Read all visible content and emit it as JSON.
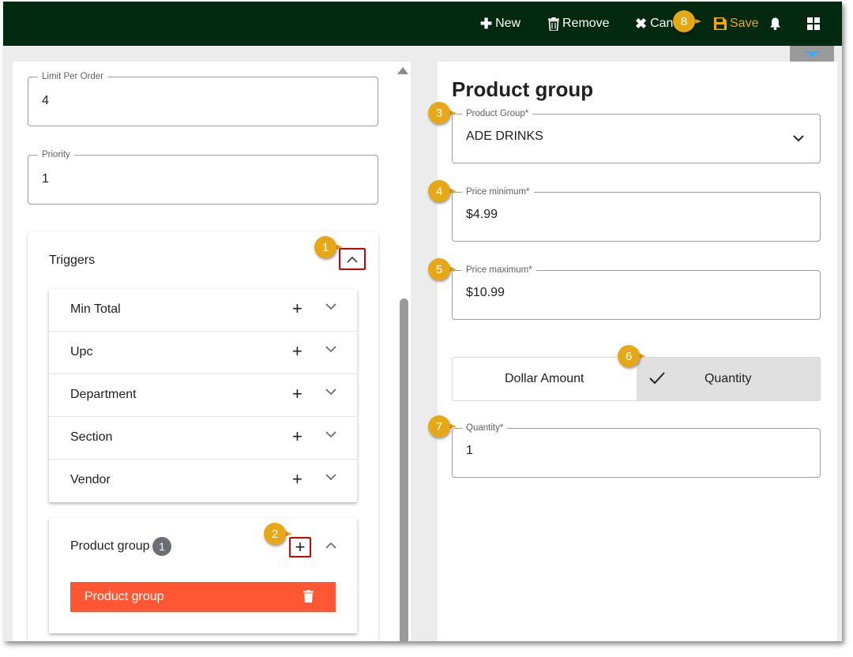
{
  "toolbar": {
    "new_label": "New",
    "remove_label": "Remove",
    "cancel_label": "Can",
    "save_label": "Save",
    "save_color": "#f5a800",
    "bar_color": "#002910"
  },
  "left": {
    "limit_per_order": {
      "label": "Limit Per Order",
      "value": "4"
    },
    "priority": {
      "label": "Priority",
      "value": "1"
    },
    "triggers_title": "Triggers",
    "trigger_items": [
      {
        "label": "Min Total"
      },
      {
        "label": "Upc"
      },
      {
        "label": "Department"
      },
      {
        "label": "Section"
      },
      {
        "label": "Vendor"
      }
    ],
    "product_group_section": {
      "title": "Product group",
      "count": "1",
      "item_label": "Product group",
      "item_color": "#ff5733"
    }
  },
  "right": {
    "title": "Product group",
    "product_group": {
      "label": "Product Group*",
      "value": "ADE DRINKS"
    },
    "price_minimum": {
      "label": "Price minimum*",
      "value": "$4.99"
    },
    "price_maximum": {
      "label": "Price maximum*",
      "value": "$10.99"
    },
    "toggle": {
      "dollar_label": "Dollar Amount",
      "quantity_label": "Quantity",
      "selected": "Quantity"
    },
    "quantity": {
      "label": "Quantity*",
      "value": "1"
    }
  },
  "callouts": [
    "1",
    "2",
    "3",
    "4",
    "5",
    "6",
    "7",
    "8"
  ],
  "callout_color": "#e6a817"
}
